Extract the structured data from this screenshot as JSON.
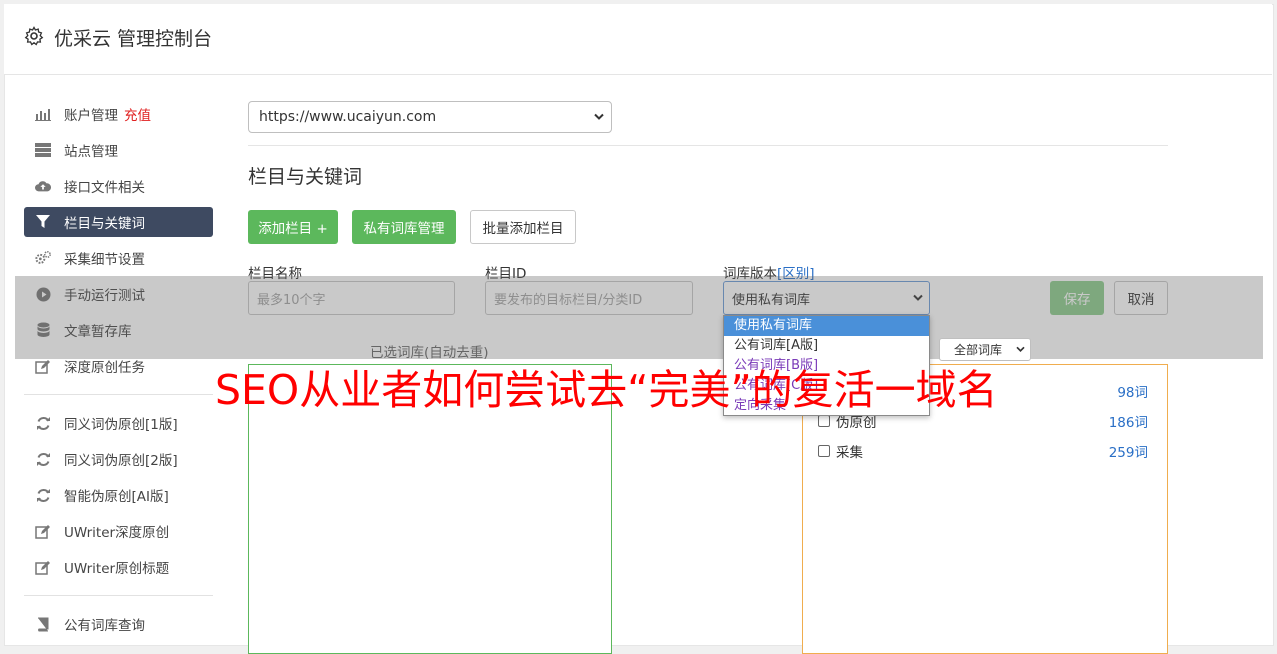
{
  "header": {
    "title": "优采云 管理控制台",
    "icon": "gear-icon"
  },
  "sidebar": {
    "items": [
      {
        "label": "账户管理",
        "badge": "充值",
        "icon": "bar-chart-icon"
      },
      {
        "label": "站点管理",
        "icon": "server-icon"
      },
      {
        "label": "接口文件相关",
        "icon": "cloud-upload-icon"
      },
      {
        "label": "栏目与关键词",
        "icon": "filter-icon",
        "active": true
      },
      {
        "label": "采集细节设置",
        "icon": "gears-icon"
      },
      {
        "label": "手动运行测试",
        "icon": "play-circle-icon"
      },
      {
        "label": "文章暂存库",
        "icon": "database-icon"
      },
      {
        "label": "深度原创任务",
        "icon": "edit-icon"
      },
      {
        "label": "同义词伪原创[1版]",
        "icon": "refresh-icon"
      },
      {
        "label": "同义词伪原创[2版]",
        "icon": "refresh-icon"
      },
      {
        "label": "智能伪原创[AI版]",
        "icon": "refresh-icon"
      },
      {
        "label": "UWriter深度原创",
        "icon": "edit-icon"
      },
      {
        "label": "UWriter原创标题",
        "icon": "edit-icon"
      },
      {
        "label": "公有词库查询",
        "icon": "book-icon"
      }
    ]
  },
  "main": {
    "site_select": {
      "value": "https://www.ucaiyun.com"
    },
    "section_title": "栏目与关键词",
    "buttons": {
      "add_column": "添加栏目 +",
      "private_lib": "私有词库管理",
      "batch_add": "批量添加栏目"
    },
    "form": {
      "name_label": "栏目名称",
      "name_placeholder": "最多10个字",
      "id_label": "栏目ID",
      "id_placeholder": "要发布的目标栏目/分类ID",
      "version_label": "词库版本",
      "version_link": "[区别]",
      "version_value": "使用私有词库",
      "save": "保存",
      "cancel": "取消"
    },
    "dropdown_options": [
      "使用私有词库",
      "公有词库[A版]",
      "公有词库[B版]",
      "公有词库[C版]",
      "定向采集"
    ],
    "selected_libs_title": "已选词库(自动去重)",
    "lib_filter": "全部词库",
    "libraries": [
      {
        "name": "",
        "count": "98词"
      },
      {
        "name": "伪原创",
        "count": "186词"
      },
      {
        "name": "采集",
        "count": "259词"
      }
    ]
  },
  "overlay_text": "SEO从业者如何尝试去“完美”的复活一域名"
}
